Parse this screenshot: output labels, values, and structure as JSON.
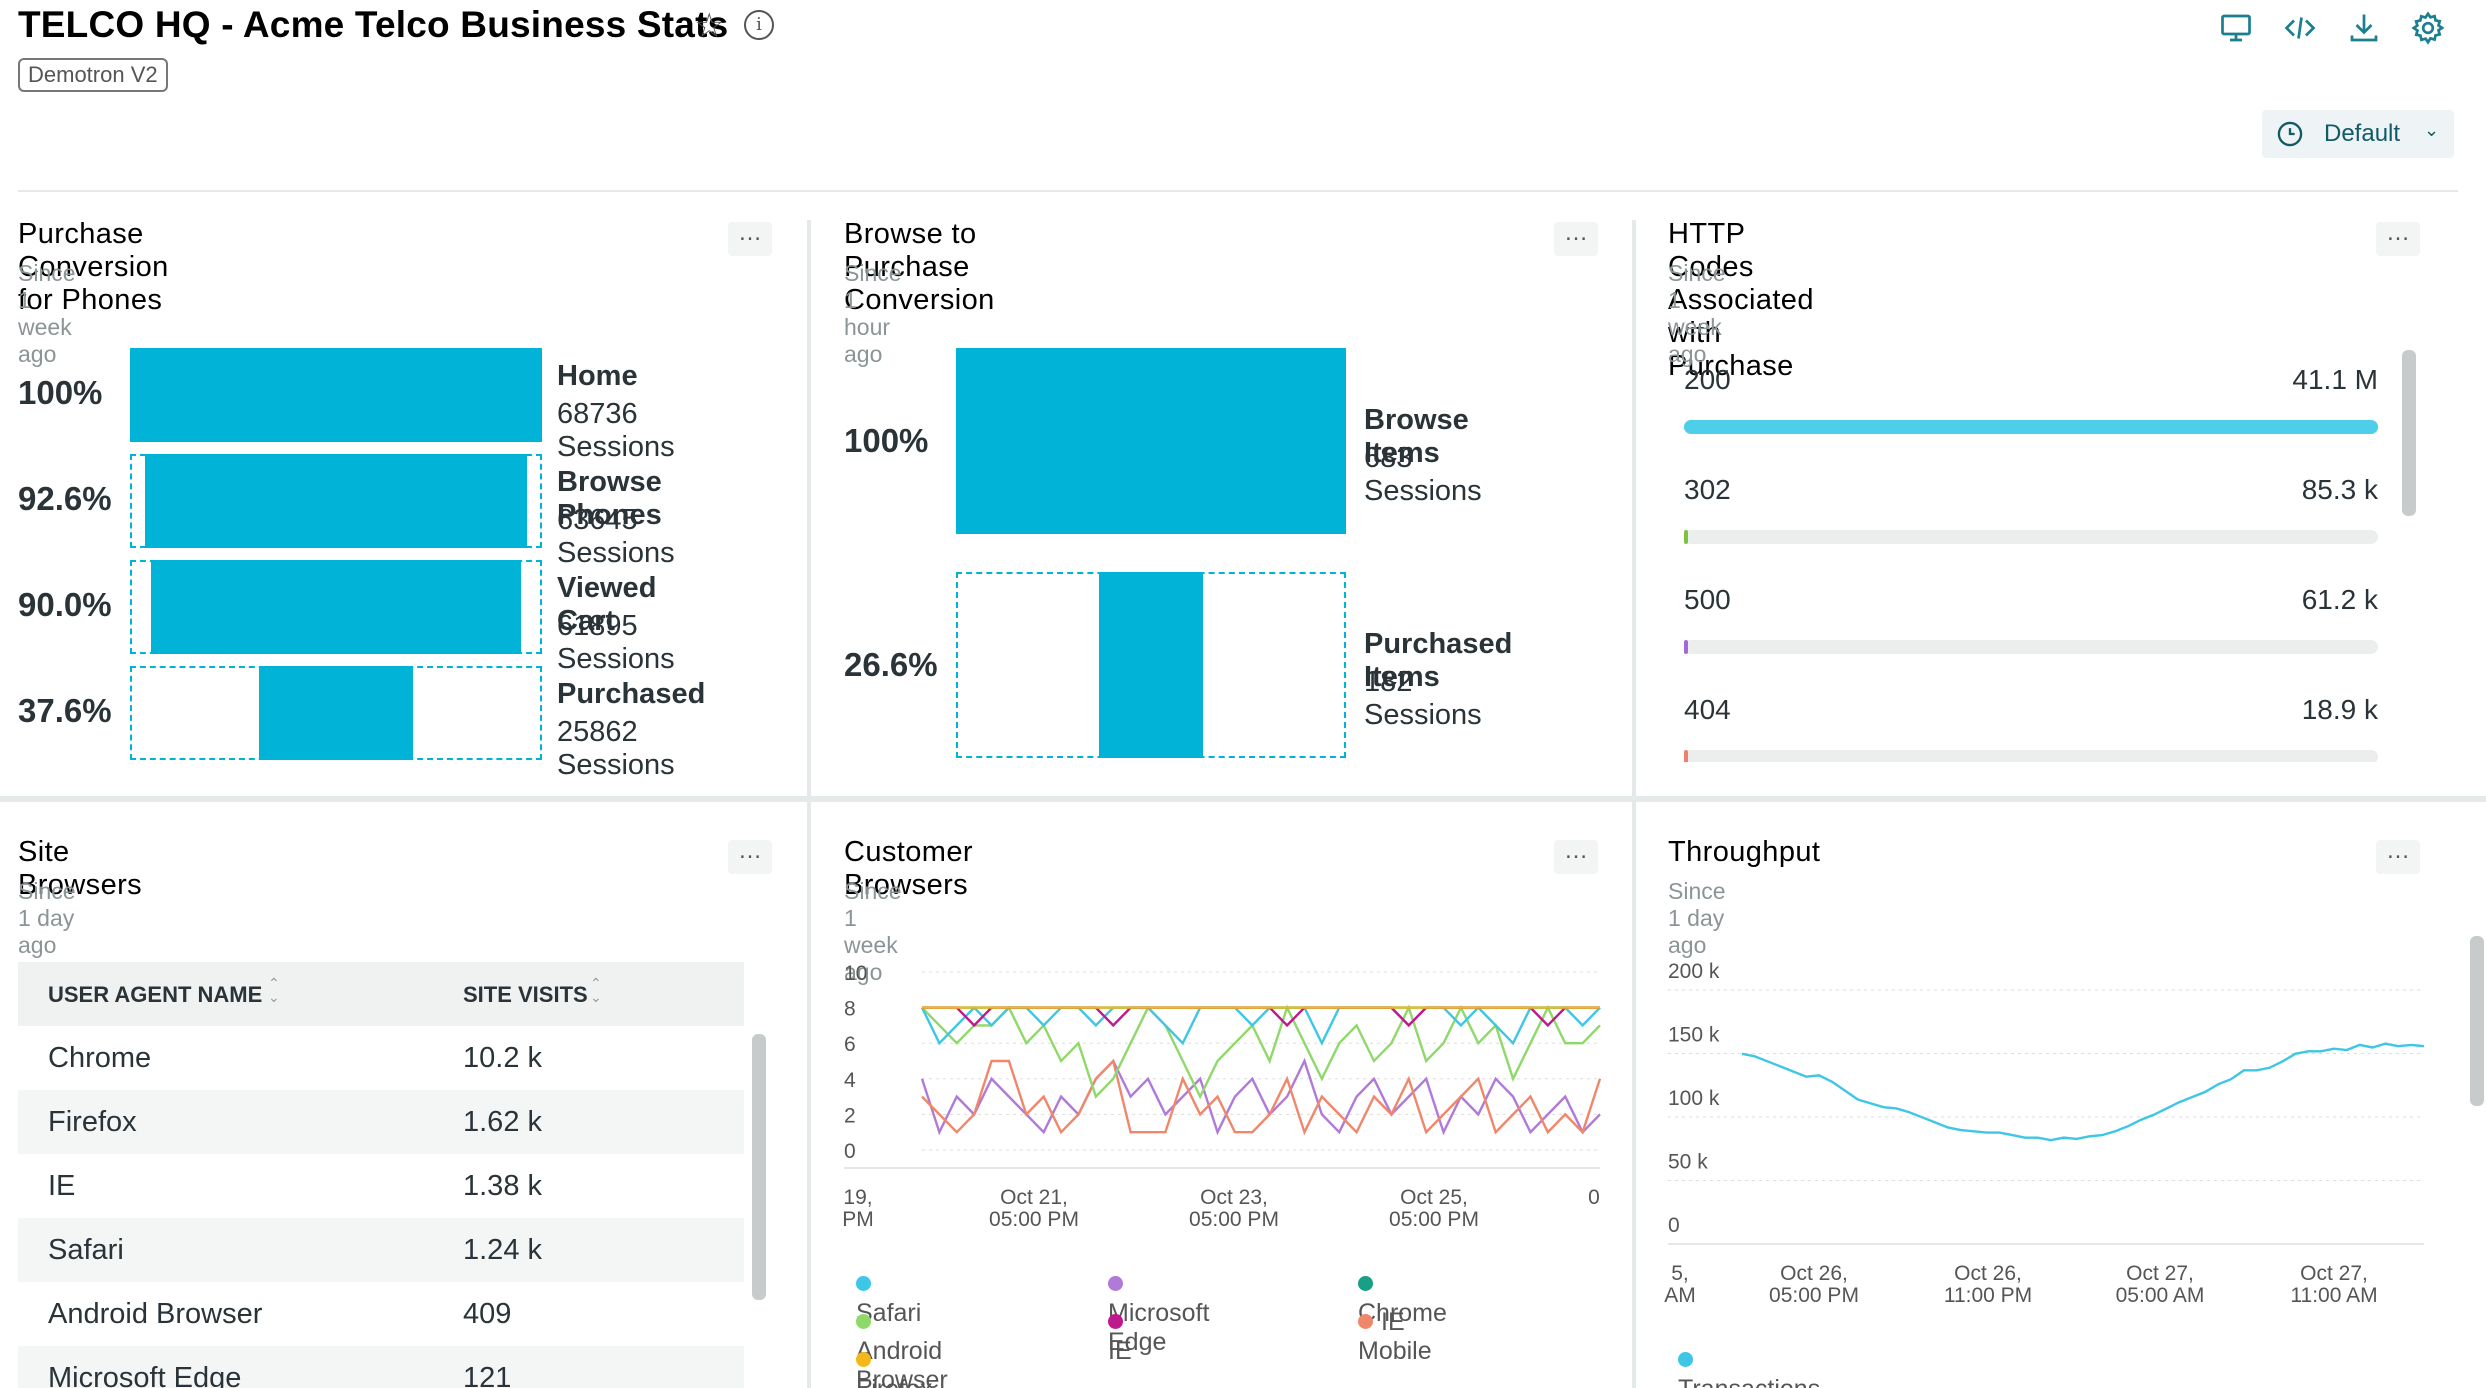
{
  "header": {
    "title": "TELCO HQ - Acme Telco Business Stats",
    "account_tag": "Demotron V2",
    "time_range": "Default"
  },
  "panels": {
    "funnel_phones": {
      "title": "Purchase Conversion for Phones",
      "subtitle": "Since 1 week ago",
      "steps": [
        {
          "pct": "100%",
          "label": "Home",
          "sessions": "68736 Sessions",
          "fraction": 1.0
        },
        {
          "pct": "92.6%",
          "label": "Browse Phones",
          "sessions": "63645 Sessions",
          "fraction": 0.926
        },
        {
          "pct": "90.0%",
          "label": "Viewed Cart",
          "sessions": "61895 Sessions",
          "fraction": 0.9
        },
        {
          "pct": "37.6%",
          "label": "Purchased",
          "sessions": "25862 Sessions",
          "fraction": 0.376
        }
      ]
    },
    "funnel_browse": {
      "title": "Browse to Purchase Conversion",
      "subtitle": "Since 1 hour ago",
      "steps": [
        {
          "pct": "100%",
          "label": "Browse Items",
          "sessions": "683 Sessions",
          "fraction": 1.0
        },
        {
          "pct": "26.6%",
          "label": "Purchased Items",
          "sessions": "182 Sessions",
          "fraction": 0.266
        }
      ]
    },
    "http_codes": {
      "title": "HTTP Codes Associated with Purchase",
      "subtitle": "Since 1 week ago",
      "rows": [
        {
          "code": "200",
          "value": "41.1 M",
          "fraction": 1.0,
          "color": "#4dcfea"
        },
        {
          "code": "302",
          "value": "85.3 k",
          "fraction": 0.002,
          "color": "#7fc241"
        },
        {
          "code": "500",
          "value": "61.2 k",
          "fraction": 0.0015,
          "color": "#a06bd6"
        },
        {
          "code": "404",
          "value": "18.9 k",
          "fraction": 0.0005,
          "color": "#f0806a"
        }
      ]
    },
    "site_browsers": {
      "title": "Site Browsers",
      "subtitle": "Since 1 day ago",
      "columns": [
        "USER AGENT NAME",
        "SITE VISITS"
      ],
      "rows": [
        [
          "Chrome",
          "10.2 k"
        ],
        [
          "Firefox",
          "1.62 k"
        ],
        [
          "IE",
          "1.38 k"
        ],
        [
          "Safari",
          "1.24 k"
        ],
        [
          "Android Browser",
          "409"
        ],
        [
          "Microsoft Edge",
          "121"
        ]
      ]
    },
    "customer_browsers": {
      "title": "Customer Browsers",
      "subtitle": "Since 1 week ago",
      "yticks": [
        "10",
        "8",
        "6",
        "4",
        "2",
        "0"
      ],
      "xticks": [
        [
          "19,",
          "PM"
        ],
        [
          "Oct 21,",
          "05:00 PM"
        ],
        [
          "Oct 23,",
          "05:00 PM"
        ],
        [
          "Oct 25,",
          "05:00 PM"
        ],
        [
          "0",
          ""
        ]
      ],
      "legend": [
        {
          "name": "Safari",
          "color": "#3ec6e6"
        },
        {
          "name": "Microsoft Edge",
          "color": "#b07ad8"
        },
        {
          "name": "Chrome",
          "color": "#1a9f87"
        },
        {
          "name": "Android Browser",
          "color": "#8fd86a"
        },
        {
          "name": "IE",
          "color": "#c0188e"
        },
        {
          "name": "IE Mobile",
          "color": "#f0876b"
        },
        {
          "name": "Firefox",
          "color": "#f4b81c"
        }
      ]
    },
    "throughput": {
      "title": "Throughput",
      "subtitle": "Since 1 day ago",
      "yticks": [
        "200 k",
        "150 k",
        "100 k",
        "50 k",
        "0"
      ],
      "xticks": [
        [
          "5,",
          "AM"
        ],
        [
          "Oct 26,",
          "05:00 PM"
        ],
        [
          "Oct 26,",
          "11:00 PM"
        ],
        [
          "Oct 27,",
          "05:00 AM"
        ],
        [
          "Oct 27,",
          "11:00 AM"
        ]
      ],
      "legend": [
        {
          "name": "Transactions",
          "color": "#3ec6e6"
        }
      ]
    }
  },
  "chart_data": [
    {
      "type": "line",
      "y_range": [
        0,
        10
      ],
      "series": [
        {
          "name": "Firefox",
          "values": [
            8,
            8,
            8,
            8,
            8,
            8,
            8,
            8,
            8,
            8,
            8,
            8,
            8,
            8,
            8,
            8,
            8,
            8,
            8,
            8,
            8,
            8,
            8,
            8,
            8,
            8,
            8,
            8,
            8,
            8,
            8,
            8,
            8,
            8,
            8,
            8,
            8,
            8,
            8,
            8
          ]
        },
        {
          "name": "Chrome",
          "values": [
            8,
            8,
            8,
            8,
            8,
            8,
            8,
            8,
            8,
            8,
            8,
            8,
            8,
            8,
            8,
            8,
            8,
            8,
            8,
            8,
            8,
            8,
            8,
            8,
            8,
            8,
            8,
            8,
            8,
            8,
            8,
            8,
            8,
            8,
            8,
            8,
            8,
            8,
            8,
            8
          ]
        },
        {
          "name": "Safari",
          "values": [
            8,
            6,
            7,
            8,
            7,
            8,
            8,
            7,
            8,
            8,
            7,
            8,
            8,
            8,
            7,
            6,
            8,
            8,
            8,
            7,
            8,
            8,
            8,
            6,
            8,
            8,
            8,
            8,
            7,
            8,
            8,
            7,
            8,
            7,
            6,
            8,
            8,
            8,
            7,
            8
          ]
        },
        {
          "name": "Android Browser",
          "values": [
            8,
            7,
            6,
            7,
            7,
            8,
            6,
            7,
            5,
            6,
            3,
            4,
            6,
            8,
            7,
            5,
            3,
            5,
            6,
            7,
            5,
            8,
            6,
            4,
            6,
            7,
            5,
            6,
            8,
            5,
            6,
            8,
            6,
            7,
            4,
            6,
            8,
            6,
            6,
            7
          ]
        },
        {
          "name": "Microsoft Edge",
          "values": [
            4,
            1,
            3,
            2,
            4,
            3,
            2,
            1,
            3,
            2,
            4,
            5,
            3,
            4,
            2,
            3,
            4,
            1,
            3,
            4,
            2,
            3,
            5,
            2,
            1,
            3,
            4,
            2,
            3,
            4,
            1,
            3,
            2,
            4,
            3,
            1,
            2,
            3,
            1,
            2
          ]
        },
        {
          "name": "IE Mobile",
          "values": [
            3,
            2,
            1,
            2,
            5,
            5,
            2,
            3,
            1,
            2,
            4,
            5,
            1,
            1,
            1,
            4,
            2,
            3,
            1,
            1,
            2,
            4,
            1,
            3,
            2,
            1,
            3,
            2,
            4,
            1,
            2,
            3,
            4,
            1,
            2,
            3,
            1,
            2,
            1,
            4
          ]
        },
        {
          "name": "IE",
          "values": [
            8,
            8,
            8,
            7,
            8,
            8,
            8,
            8,
            8,
            8,
            8,
            7,
            8,
            8,
            8,
            8,
            8,
            8,
            8,
            8,
            8,
            7,
            8,
            8,
            8,
            8,
            8,
            8,
            7,
            8,
            8,
            8,
            8,
            8,
            8,
            8,
            7,
            8,
            8,
            8
          ]
        }
      ]
    },
    {
      "type": "line",
      "y_range": [
        0,
        200000
      ],
      "series": [
        {
          "name": "Transactions",
          "values": [
            134000,
            132000,
            128000,
            124000,
            120000,
            116000,
            117000,
            112000,
            105000,
            98000,
            95000,
            92000,
            91000,
            88000,
            84000,
            80000,
            76000,
            74000,
            73000,
            72000,
            72000,
            70000,
            68000,
            68000,
            66000,
            68000,
            67000,
            69000,
            70000,
            73000,
            77000,
            82000,
            86000,
            91000,
            96000,
            100000,
            104000,
            110000,
            114000,
            121000,
            121000,
            123000,
            128000,
            134000,
            136000,
            136000,
            138000,
            137000,
            141000,
            139000,
            142000,
            140000,
            141000,
            140000
          ]
        }
      ]
    }
  ]
}
